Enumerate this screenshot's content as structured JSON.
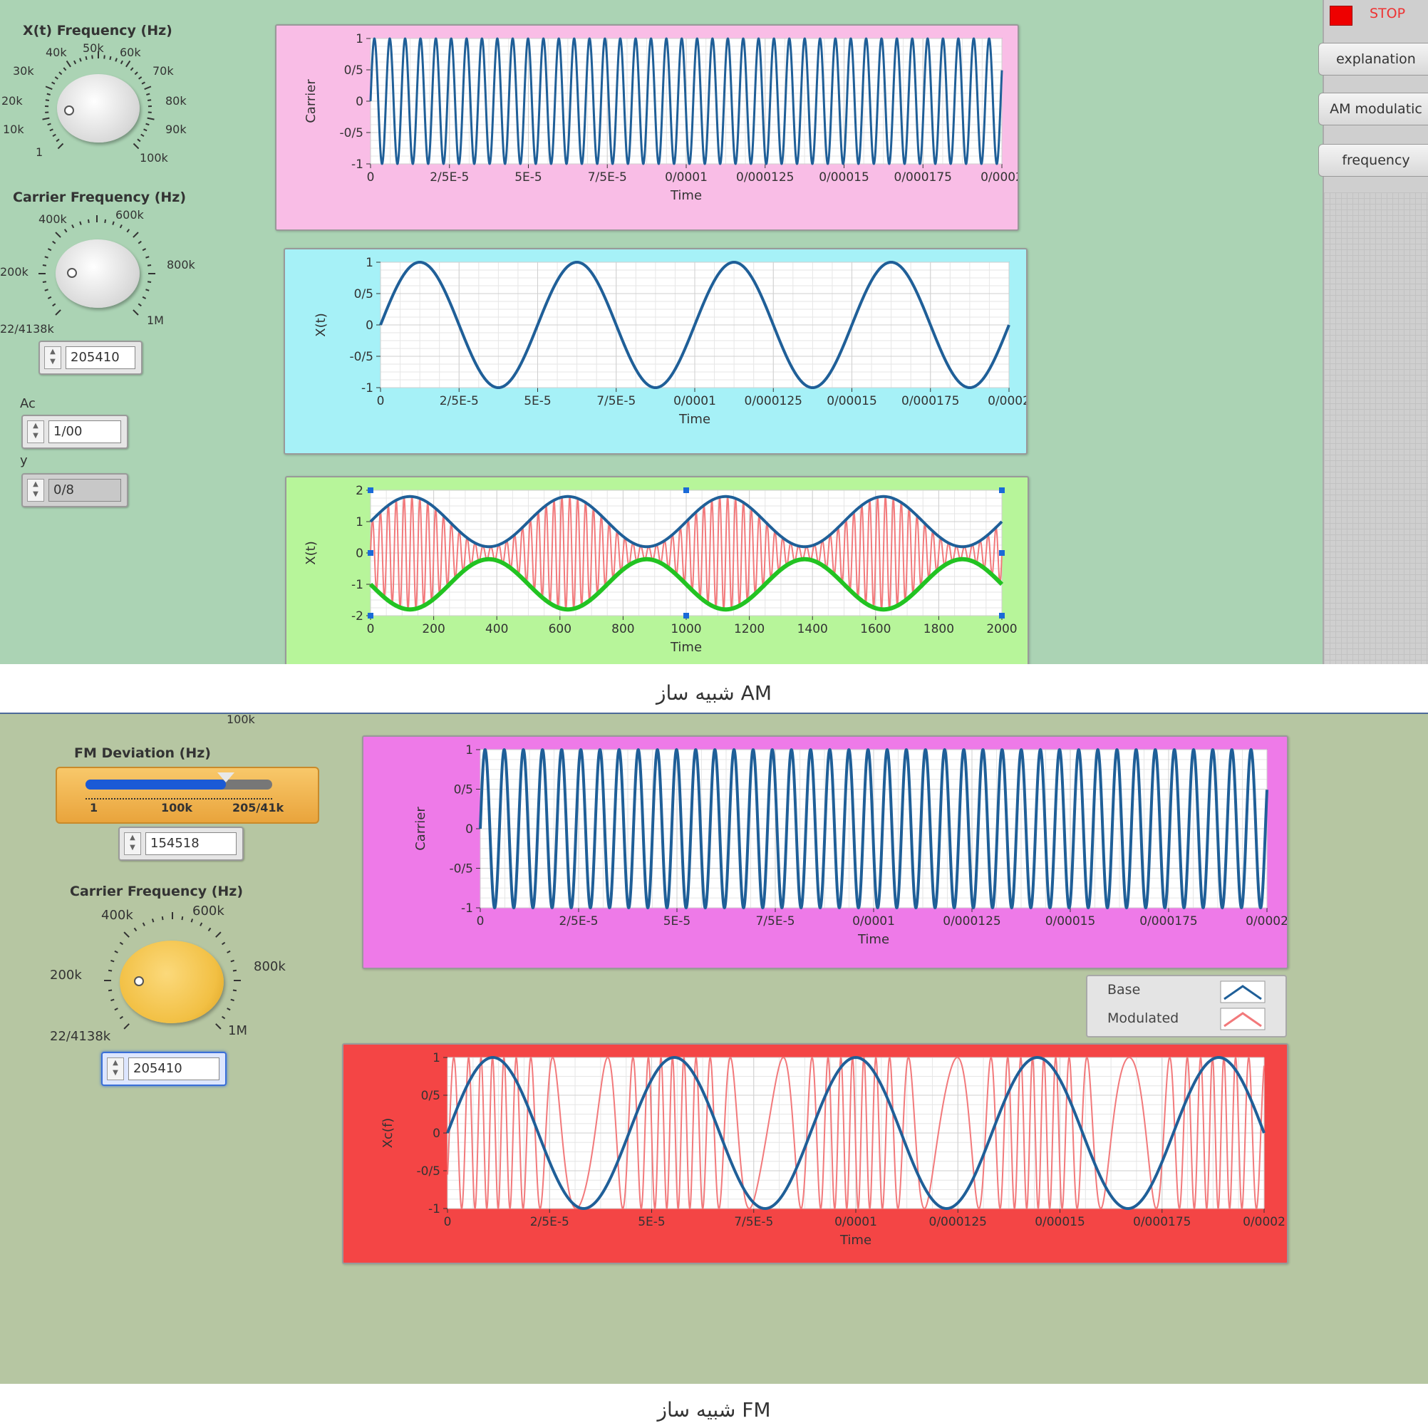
{
  "am": {
    "stop_label": "STOP",
    "side_buttons": [
      "explanation",
      "AM modulatic",
      "frequency"
    ],
    "xfreq_label": "X(t) Frequency (Hz)",
    "xfreq_ticks": [
      "1",
      "10k",
      "20k",
      "30k",
      "40k",
      "50k",
      "60k",
      "70k",
      "80k",
      "90k",
      "100k"
    ],
    "carrier_label": "Carrier Frequency (Hz)",
    "carrier_ticks": [
      "22/4138k",
      "200k",
      "400k",
      "600k",
      "800k",
      "1M"
    ],
    "carrier_value": "205410",
    "ac_label": "Ac",
    "ac_value": "1/00",
    "y_label": "y",
    "y_value": "0/8",
    "caption": "شبیه ساز AM",
    "colors": {
      "panel": "#abd3b4",
      "graph1": "#f9bde6",
      "graph2": "#a6f1f7",
      "graph3": "#b7f59a"
    }
  },
  "fm": {
    "partial_tick": "100k",
    "dev_label": "FM Deviation (Hz)",
    "dev_ticks": [
      "1",
      "100k",
      "205/41k"
    ],
    "dev_fill": 0.75,
    "dev_value": "154518",
    "carrier_label": "Carrier Frequency (Hz)",
    "carrier_ticks": [
      "22/4138k",
      "200k",
      "400k",
      "600k",
      "800k",
      "1M"
    ],
    "carrier_value": "205410",
    "legend": [
      "Base",
      "Modulated"
    ],
    "caption": "شبیه ساز FM",
    "colors": {
      "panel": "#b6c6a2",
      "graph1": "#ee7ae8",
      "graph2": "#f44545",
      "knob": "#f2c044",
      "slider": "#f3b54f"
    }
  },
  "chart_data": [
    {
      "id": "am-carrier",
      "type": "line",
      "xlabel": "Time",
      "ylabel": "Carrier",
      "x_ticks": [
        "0",
        "2/5E-5",
        "5E-5",
        "7/5E-5",
        "0/0001",
        "0/000125",
        "0/00015",
        "0/000175",
        "0/0002"
      ],
      "y_ticks": [
        "1",
        "0/5",
        "0",
        "-0/5",
        "-1"
      ],
      "xlim": [
        0,
        0.0002
      ],
      "ylim": [
        -1,
        1
      ],
      "series": [
        {
          "function": "sin",
          "frequency_hz": 205410,
          "amplitude": 1,
          "color": "#1f5f98"
        }
      ]
    },
    {
      "id": "am-message",
      "type": "line",
      "xlabel": "Time",
      "ylabel": "X(t)",
      "x_ticks": [
        "0",
        "2/5E-5",
        "5E-5",
        "7/5E-5",
        "0/0001",
        "0/000125",
        "0/00015",
        "0/000175",
        "0/0002"
      ],
      "y_ticks": [
        "1",
        "0/5",
        "0",
        "-0/5",
        "-1"
      ],
      "xlim": [
        0,
        0.0002
      ],
      "ylim": [
        -1,
        1
      ],
      "series": [
        {
          "function": "sin",
          "frequency_hz": 20000,
          "amplitude": 1,
          "color": "#1f5f98"
        }
      ]
    },
    {
      "id": "am-modulated",
      "type": "line",
      "xlabel": "Time",
      "ylabel": "X(t)",
      "x_ticks": [
        "0",
        "200",
        "400",
        "600",
        "800",
        "1000",
        "1200",
        "1400",
        "1600",
        "1800",
        "2000"
      ],
      "y_ticks": [
        "2",
        "1",
        "0",
        "-1",
        "-2"
      ],
      "xlim": [
        0,
        2000
      ],
      "ylim": [
        -2,
        2
      ],
      "series": [
        {
          "name": "modulated",
          "color": "#f2797b",
          "carrier_cycles": 80,
          "envelope_cycles": 4,
          "ac": 1.0,
          "y": 0.8
        },
        {
          "name": "upper envelope",
          "color": "#1f5f98"
        },
        {
          "name": "lower envelope",
          "color": "#22c322"
        }
      ]
    },
    {
      "id": "fm-carrier",
      "type": "line",
      "xlabel": "Time",
      "ylabel": "Carrier",
      "x_ticks": [
        "0",
        "2/5E-5",
        "5E-5",
        "7/5E-5",
        "0/0001",
        "0/000125",
        "0/00015",
        "0/000175",
        "0/0002"
      ],
      "y_ticks": [
        "1",
        "0/5",
        "0",
        "-0/5",
        "-1"
      ],
      "xlim": [
        0,
        0.0002
      ],
      "ylim": [
        -1,
        1
      ],
      "series": [
        {
          "function": "sin",
          "frequency_hz": 205410,
          "amplitude": 1,
          "color": "#1f5f98"
        }
      ]
    },
    {
      "id": "fm-modulated",
      "type": "line",
      "xlabel": "Time",
      "ylabel": "Xc(f)",
      "x_ticks": [
        "0",
        "2/5E-5",
        "5E-5",
        "7/5E-5",
        "0/0001",
        "0/000125",
        "0/00015",
        "0/000175",
        "0/0002"
      ],
      "y_ticks": [
        "1",
        "0/5",
        "0",
        "-0/5",
        "-1"
      ],
      "xlim": [
        0,
        0.0002
      ],
      "ylim": [
        -1,
        1
      ],
      "series": [
        {
          "name": "Base",
          "function": "sin",
          "frequency_hz": 22500,
          "amplitude": 1,
          "color": "#1f5f98"
        },
        {
          "name": "Modulated",
          "carrier_hz": 205410,
          "deviation_hz": 154518,
          "color": "#f2797b"
        }
      ]
    }
  ]
}
